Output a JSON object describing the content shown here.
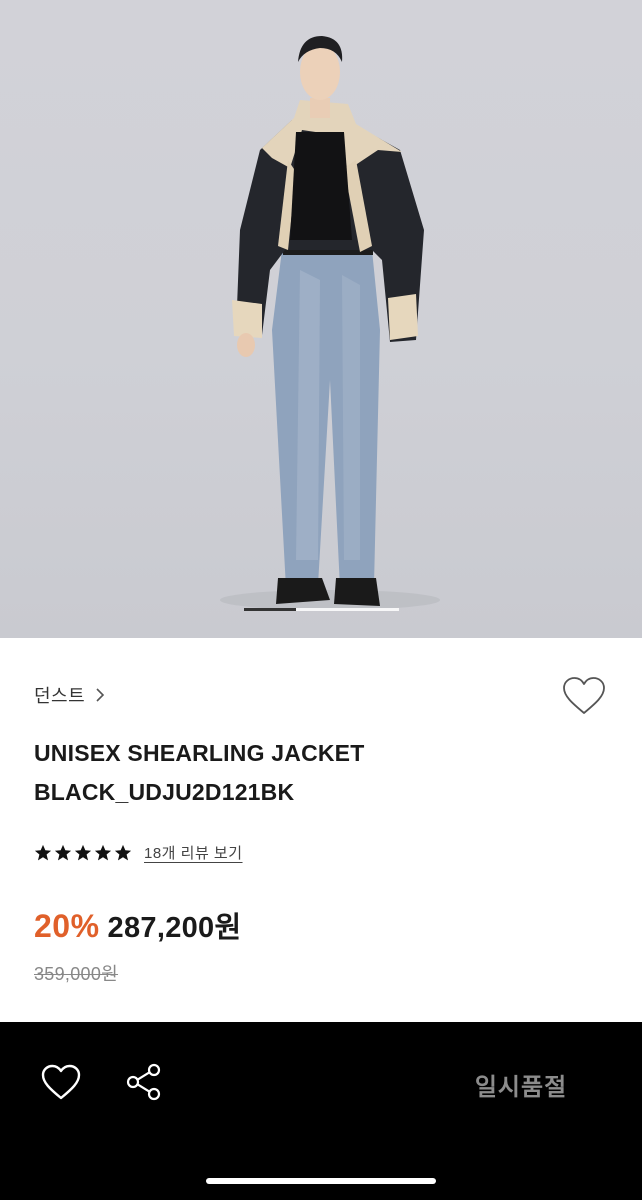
{
  "hero": {
    "slide_index": 1,
    "slide_count": 3,
    "icon": "product-photo"
  },
  "product": {
    "brand": "던스트",
    "title_line1": "UNISEX SHEARLING JACKET",
    "title_line2": "BLACK_UDJU2D121BK",
    "rating_stars": 5,
    "review_link": "18개 리뷰 보기",
    "discount": "20%",
    "price": "287,200원",
    "original_price": "359,000원"
  },
  "bottom_bar": {
    "soldout_label": "일시품절",
    "icons": [
      "heart-outline-icon",
      "share-icon"
    ]
  },
  "colors": {
    "discount": "#e0602a",
    "bar_background": "#000000",
    "soldout_text": "#8c8c8c"
  }
}
